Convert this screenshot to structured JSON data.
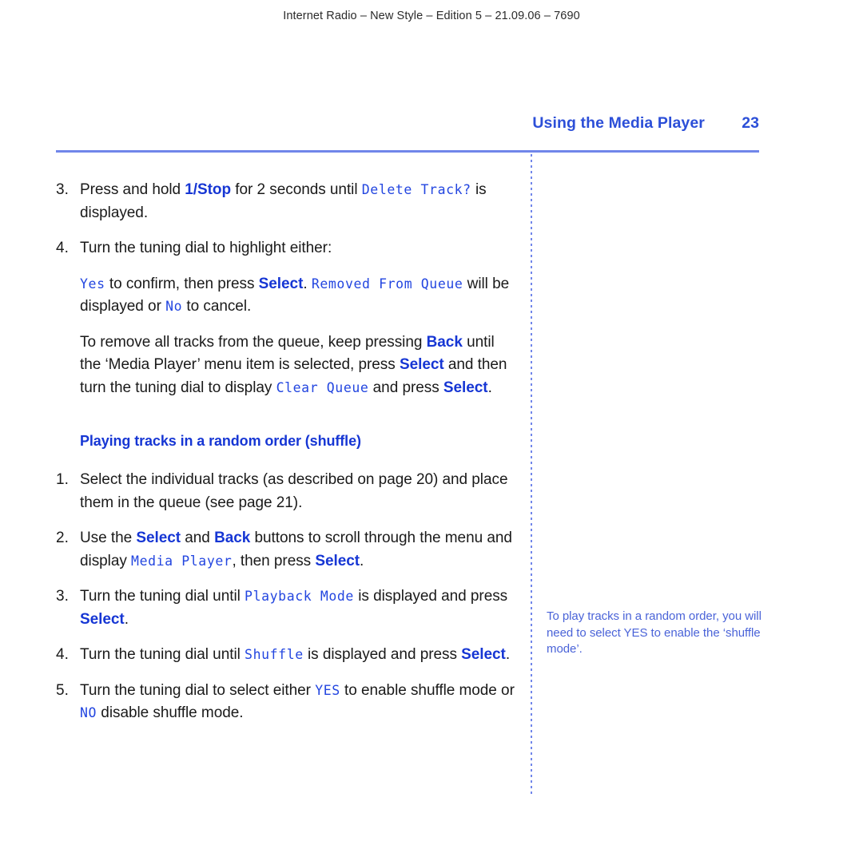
{
  "doc": {
    "header_line": "Internet Radio – New Style – Edition 5 – 21.09.06 – 7690",
    "running_head_title": "Using the Media Player",
    "page_number": "23",
    "rule_color": "#7186ea",
    "accent_blue": "#1636d4",
    "lcd_blue": "#2346e0",
    "note_blue": "#4a63d8"
  },
  "steps_top": [
    {
      "number": "3.",
      "parts": [
        {
          "t": "Press and hold ",
          "s": "plain"
        },
        {
          "t": "1/Stop",
          "s": "btn"
        },
        {
          "t": " for 2 seconds until ",
          "s": "plain"
        },
        {
          "t": "Delete Track?",
          "s": "lcd"
        },
        {
          "t": " is displayed.",
          "s": "plain"
        }
      ]
    },
    {
      "number": "4.",
      "parts": [
        {
          "t": "Turn the tuning dial to highlight either:",
          "s": "plain"
        }
      ]
    }
  ],
  "paragraphs": [
    {
      "name": "confirm-paragraph",
      "parts": [
        {
          "t": "Yes",
          "s": "lcd"
        },
        {
          "t": " to confirm, then press ",
          "s": "plain"
        },
        {
          "t": "Select",
          "s": "btn"
        },
        {
          "t": ". ",
          "s": "plain"
        },
        {
          "t": "Removed From Queue",
          "s": "lcd"
        },
        {
          "t": " will be displayed or ",
          "s": "plain"
        },
        {
          "t": "No",
          "s": "lcd"
        },
        {
          "t": " to cancel.",
          "s": "plain"
        }
      ]
    },
    {
      "name": "clear-queue-paragraph",
      "parts": [
        {
          "t": "To remove all tracks from the queue, keep pressing ",
          "s": "plain"
        },
        {
          "t": "Back",
          "s": "btn"
        },
        {
          "t": " until the ‘Media Player’ menu item is selected, press ",
          "s": "plain"
        },
        {
          "t": "Select",
          "s": "btn"
        },
        {
          "t": " and then turn the tuning dial to display ",
          "s": "plain"
        },
        {
          "t": "Clear Queue",
          "s": "lcd"
        },
        {
          "t": " and press ",
          "s": "plain"
        },
        {
          "t": "Select",
          "s": "btn"
        },
        {
          "t": ".",
          "s": "plain"
        }
      ]
    }
  ],
  "section": {
    "heading": "Playing tracks in a random order (shuffle)"
  },
  "steps_shuffle": [
    {
      "number": "1.",
      "parts": [
        {
          "t": "Select the individual tracks (as described on page 20) and place them in the queue (see page 21).",
          "s": "plain"
        }
      ]
    },
    {
      "number": "2.",
      "parts": [
        {
          "t": "Use the ",
          "s": "plain"
        },
        {
          "t": "Select",
          "s": "btn"
        },
        {
          "t": " and ",
          "s": "plain"
        },
        {
          "t": "Back",
          "s": "btn"
        },
        {
          "t": " buttons to scroll through the menu and display ",
          "s": "plain"
        },
        {
          "t": "Media Player",
          "s": "lcd"
        },
        {
          "t": ", then press ",
          "s": "plain"
        },
        {
          "t": "Select",
          "s": "btn"
        },
        {
          "t": ".",
          "s": "plain"
        }
      ]
    },
    {
      "number": "3.",
      "parts": [
        {
          "t": "Turn the tuning dial until ",
          "s": "plain"
        },
        {
          "t": "Playback Mode",
          "s": "lcd"
        },
        {
          "t": " is displayed and press ",
          "s": "plain"
        },
        {
          "t": "Select",
          "s": "btn"
        },
        {
          "t": ".",
          "s": "plain"
        }
      ]
    },
    {
      "number": "4.",
      "parts": [
        {
          "t": "Turn the tuning dial until ",
          "s": "plain"
        },
        {
          "t": "Shuffle",
          "s": "lcd"
        },
        {
          "t": " is displayed and press ",
          "s": "plain"
        },
        {
          "t": "Select",
          "s": "btn"
        },
        {
          "t": ".",
          "s": "plain"
        }
      ]
    },
    {
      "number": "5.",
      "parts": [
        {
          "t": "Turn the tuning dial to select either ",
          "s": "plain"
        },
        {
          "t": "YES",
          "s": "lcd"
        },
        {
          "t": " to enable shuffle mode or ",
          "s": "plain"
        },
        {
          "t": "NO",
          "s": "lcd"
        },
        {
          "t": " disable shuffle mode.",
          "s": "plain"
        }
      ]
    }
  ],
  "side_note": {
    "text": "To play tracks in a random order, you will need to select YES to enable the ‘shuffle mode’."
  }
}
